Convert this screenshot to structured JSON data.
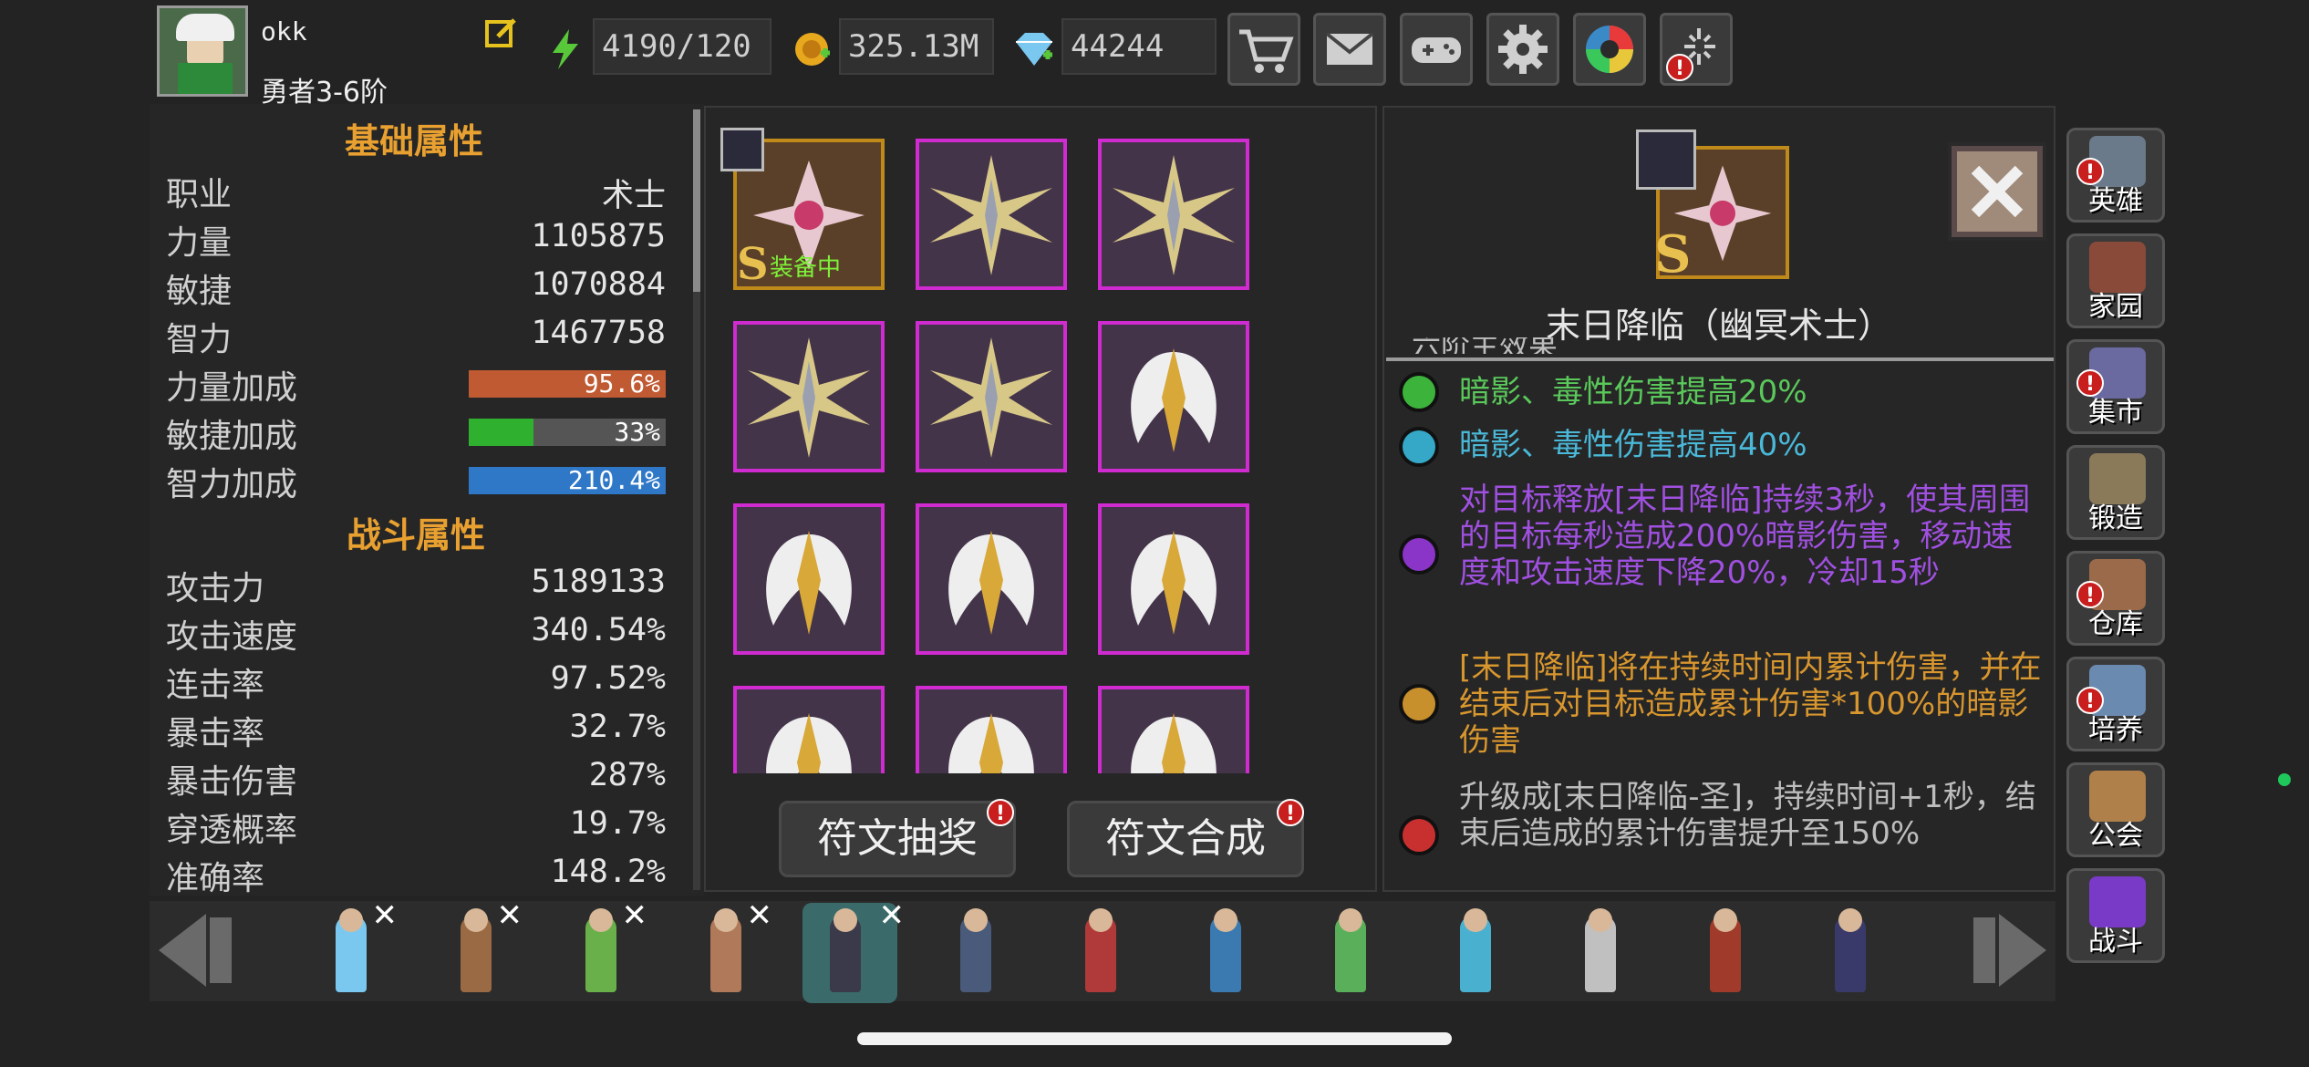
{
  "player": {
    "name": "okk",
    "rank": "勇者3-6阶"
  },
  "resources": {
    "stamina": "4190/120",
    "gold": "325.13M",
    "diamonds": "44244"
  },
  "top_icons": [
    "cart-icon",
    "mail-icon",
    "gamepad-icon",
    "gear-icon",
    "camera-shutter-icon",
    "fireworks-icon"
  ],
  "basic_attributes": {
    "title": "基础属性",
    "rows": [
      {
        "label": "职业",
        "value": "术士"
      },
      {
        "label": "力量",
        "value": "1105875"
      },
      {
        "label": "敏捷",
        "value": "1070884"
      },
      {
        "label": "智力",
        "value": "1467758"
      }
    ],
    "bonuses": [
      {
        "label": "力量加成",
        "value": "95.6%",
        "fill": 1.0,
        "color": "#c05a32"
      },
      {
        "label": "敏捷加成",
        "value": "33%",
        "fill": 0.33,
        "color": "#2fb02f"
      },
      {
        "label": "智力加成",
        "value": "210.4%",
        "fill": 1.0,
        "color": "#2f78c8"
      }
    ]
  },
  "combat_attributes": {
    "title": "战斗属性",
    "rows": [
      {
        "label": "攻击力",
        "value": "5189133"
      },
      {
        "label": "攻击速度",
        "value": "340.54%"
      },
      {
        "label": "连击率",
        "value": "97.52%"
      },
      {
        "label": "暴击率",
        "value": "32.7%"
      },
      {
        "label": "暴击伤害",
        "value": "287%"
      },
      {
        "label": "穿透概率",
        "value": "19.7%"
      },
      {
        "label": "准确率",
        "value": "148.2%"
      }
    ]
  },
  "runes": {
    "equipped_label": "装备中",
    "grade": "S",
    "draw_button": "符文抽奖",
    "merge_button": "符文合成"
  },
  "detail": {
    "grade": "S",
    "title": "末日降临（幽冥术士）",
    "header_partial": "六阶主效果",
    "effects": [
      {
        "color": "#3cb43c",
        "text_color": "#5ac85a",
        "text": "暗影、毒性伤害提高20%"
      },
      {
        "color": "#35a8c8",
        "text_color": "#4ab8d8",
        "text": "暗影、毒性伤害提高40%"
      },
      {
        "color": "#8a34c8",
        "text_color": "#a050e0",
        "text": "对目标释放[末日降临]持续3秒，使其周围的目标每秒造成200%暗影伤害，移动速度和攻击速度下降20%，冷却15秒"
      },
      {
        "color": "#c8902c",
        "text_color": "#d8962e",
        "text": "[末日降临]将在持续时间内累计伤害，并在结束后对目标造成累计伤害*100%的暗影伤害"
      },
      {
        "color": "#c83030",
        "text_color": "#bdbdbd",
        "text": "升级成[末日降临-圣]，持续时间+1秒，结束后造成的累计伤害提升至150%"
      }
    ]
  },
  "side_nav": [
    {
      "label": "英雄",
      "alert": true,
      "icon": "helmet-icon"
    },
    {
      "label": "家园",
      "alert": false,
      "icon": "castle-icon"
    },
    {
      "label": "集市",
      "alert": true,
      "icon": "market-icon"
    },
    {
      "label": "锻造",
      "alert": false,
      "icon": "anvil-icon"
    },
    {
      "label": "仓库",
      "alert": true,
      "icon": "warehouse-icon"
    },
    {
      "label": "培养",
      "alert": true,
      "icon": "trophy-icon"
    },
    {
      "label": "公会",
      "alert": false,
      "icon": "guild-icon"
    },
    {
      "label": "战斗",
      "alert": false,
      "icon": "portal-icon"
    }
  ],
  "heroes": [
    {
      "name": "ice-mage",
      "selected": false,
      "removable": true,
      "color": "#7ac8f0"
    },
    {
      "name": "barbarian",
      "selected": false,
      "removable": true,
      "color": "#9a6a44"
    },
    {
      "name": "elf-archer",
      "selected": false,
      "removable": true,
      "color": "#6ab04a"
    },
    {
      "name": "amazon",
      "selected": false,
      "removable": true,
      "color": "#b07a5a"
    },
    {
      "name": "warlock",
      "selected": true,
      "removable": true,
      "color": "#3a3a4a"
    },
    {
      "name": "swordsman",
      "selected": false,
      "removable": false,
      "color": "#4a5a7a"
    },
    {
      "name": "crimson-priest",
      "selected": false,
      "removable": false,
      "color": "#b03a3a"
    },
    {
      "name": "gunner",
      "selected": false,
      "removable": false,
      "color": "#3a7ab0"
    },
    {
      "name": "druid",
      "selected": false,
      "removable": false,
      "color": "#5ab05a"
    },
    {
      "name": "frost-spirit",
      "selected": false,
      "removable": false,
      "color": "#4ab0d0"
    },
    {
      "name": "white-knight",
      "selected": false,
      "removable": false,
      "color": "#c0c0c0"
    },
    {
      "name": "scarlet-rogue",
      "selected": false,
      "removable": false,
      "color": "#a03a2a"
    },
    {
      "name": "shadow-assassin",
      "selected": false,
      "removable": false,
      "color": "#3a3a6a"
    }
  ]
}
